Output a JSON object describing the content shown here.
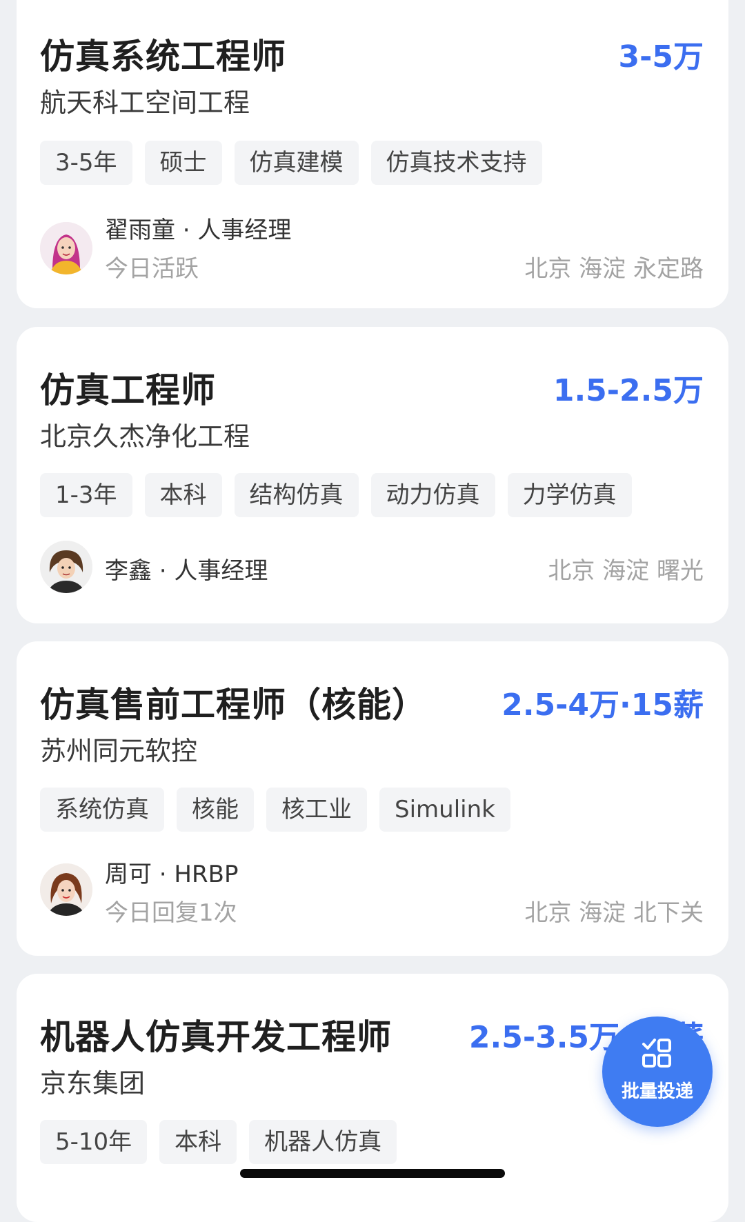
{
  "jobs": [
    {
      "title": "仿真系统工程师",
      "salary": "3-5万",
      "company": "航天科工空间工程",
      "tags": [
        "3-5年",
        "硕士",
        "仿真建模",
        "仿真技术支持"
      ],
      "recruiter": "翟雨童 · 人事经理",
      "activity": "今日活跃",
      "location": "北京 海淀 永定路"
    },
    {
      "title": "仿真工程师",
      "salary": "1.5-2.5万",
      "company": "北京久杰净化工程",
      "tags": [
        "1-3年",
        "本科",
        "结构仿真",
        "动力仿真",
        "力学仿真"
      ],
      "recruiter": "李鑫 · 人事经理",
      "activity": "",
      "location": "北京 海淀 曙光"
    },
    {
      "title": "仿真售前工程师（核能）",
      "salary": "2.5-4万·15薪",
      "company": "苏州同元软控",
      "tags": [
        "系统仿真",
        "核能",
        "核工业",
        "Simulink"
      ],
      "recruiter": "周可 · HRBP",
      "activity": "今日回复1次",
      "location": "北京 海淀 北下关"
    },
    {
      "title": "机器人仿真开发工程师",
      "salary": "2.5-3.5万·15薪",
      "company": "京东集团",
      "tags": [
        "5-10年",
        "本科",
        "机器人仿真"
      ],
      "recruiter": "",
      "activity": "",
      "location": ""
    }
  ],
  "fab": {
    "label": "批量投递",
    "icon": "batch-apply-icon"
  },
  "colors": {
    "salary": "#3b6ef0",
    "fab": "#3f7cf2",
    "background": "#eef0f3"
  }
}
